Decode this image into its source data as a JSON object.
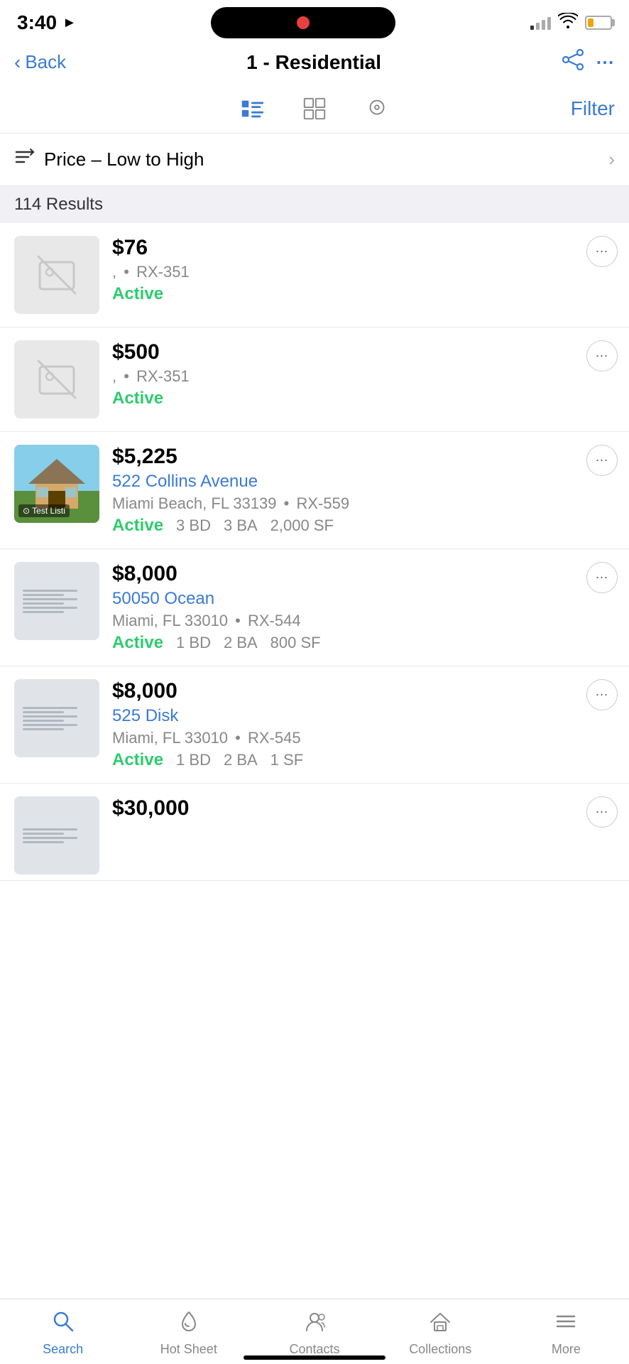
{
  "statusBar": {
    "time": "3:40",
    "batteryLevel": "25"
  },
  "header": {
    "back_label": "Back",
    "title": "1 - Residential"
  },
  "viewControls": {
    "filter_label": "Filter",
    "views": [
      "list-view",
      "grid-view",
      "map-view"
    ]
  },
  "sort": {
    "label": "Price – Low to High"
  },
  "results": {
    "count": "114 Results"
  },
  "listings": [
    {
      "id": 1,
      "price": "$76",
      "address": "",
      "address_link": "",
      "city_state": ",",
      "mls": "RX-351",
      "status": "Active",
      "beds": "",
      "baths": "",
      "sqft": "",
      "has_photo": false
    },
    {
      "id": 2,
      "price": "$500",
      "address": "",
      "address_link": "",
      "city_state": ",",
      "mls": "RX-351",
      "status": "Active",
      "beds": "",
      "baths": "",
      "sqft": "",
      "has_photo": false
    },
    {
      "id": 3,
      "price": "$5,225",
      "address": "522 Collins Avenue",
      "address_link": "522 Collins Avenue",
      "city_state": "Miami Beach, FL 33139",
      "mls": "RX-559",
      "status": "Active",
      "beds": "3 BD",
      "baths": "3 BA",
      "sqft": "2,000 SF",
      "has_photo": true,
      "photo_type": "house"
    },
    {
      "id": 4,
      "price": "$8,000",
      "address": "50050 Ocean",
      "address_link": "50050 Ocean",
      "city_state": "Miami, FL 33010",
      "mls": "RX-544",
      "status": "Active",
      "beds": "1 BD",
      "baths": "2 BA",
      "sqft": "800 SF",
      "has_photo": true,
      "photo_type": "placeholder"
    },
    {
      "id": 5,
      "price": "$8,000",
      "address": "525 Disk",
      "address_link": "525 Disk",
      "city_state": "Miami, FL 33010",
      "mls": "RX-545",
      "status": "Active",
      "beds": "1 BD",
      "baths": "2 BA",
      "sqft": "1 SF",
      "has_photo": true,
      "photo_type": "placeholder"
    },
    {
      "id": 6,
      "price": "$30,000",
      "address": "",
      "address_link": "",
      "city_state": "",
      "mls": "",
      "status": "",
      "beds": "",
      "baths": "",
      "sqft": "",
      "has_photo": true,
      "photo_type": "placeholder"
    }
  ],
  "tabBar": {
    "tabs": [
      {
        "id": "search",
        "label": "Search",
        "icon": "search"
      },
      {
        "id": "hotsheet",
        "label": "Hot Sheet",
        "icon": "flame"
      },
      {
        "id": "contacts",
        "label": "Contacts",
        "icon": "people"
      },
      {
        "id": "collections",
        "label": "Collections",
        "icon": "house"
      },
      {
        "id": "more",
        "label": "More",
        "icon": "lines"
      }
    ],
    "active": "search"
  }
}
